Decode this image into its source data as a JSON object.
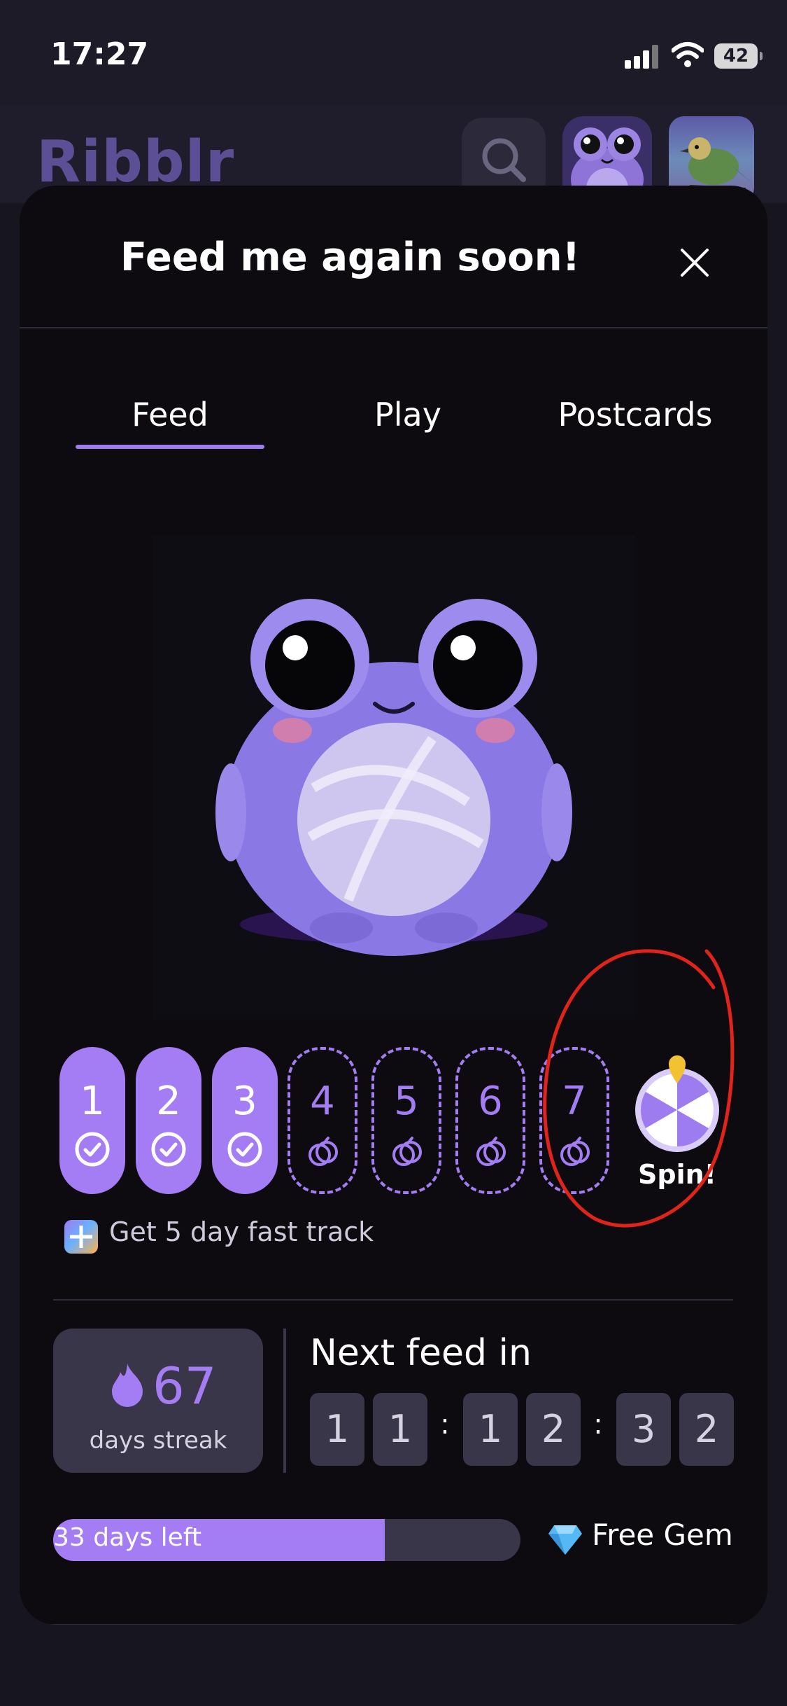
{
  "status_bar": {
    "time": "17:27",
    "battery": "42"
  },
  "header": {
    "logo": "Ribblr"
  },
  "modal": {
    "title": "Feed me again soon!",
    "tabs": [
      {
        "label": "Feed"
      },
      {
        "label": "Play"
      },
      {
        "label": "Postcards"
      }
    ],
    "active_tab": "Feed",
    "days": [
      {
        "number": "1",
        "done": true
      },
      {
        "number": "2",
        "done": true
      },
      {
        "number": "3",
        "done": true
      },
      {
        "number": "4",
        "done": false
      },
      {
        "number": "5",
        "done": false
      },
      {
        "number": "6",
        "done": false
      },
      {
        "number": "7",
        "done": false
      }
    ],
    "spin_label": "Spin!",
    "fast_track": "Get 5 day fast track",
    "streak": {
      "count": "67",
      "label": "days streak"
    },
    "next_feed": {
      "label": "Next feed in",
      "digits": [
        "1",
        "1",
        "1",
        "2",
        "3",
        "2"
      ],
      "separator": ":"
    },
    "progress": {
      "label": "33 days left",
      "fraction": 0.71
    },
    "reward": {
      "label": "Free Gem",
      "icon": "gem-icon"
    }
  },
  "colors": {
    "accent": "#a47cf3",
    "annotation": "#e0231b",
    "background": "#0d0b10"
  }
}
